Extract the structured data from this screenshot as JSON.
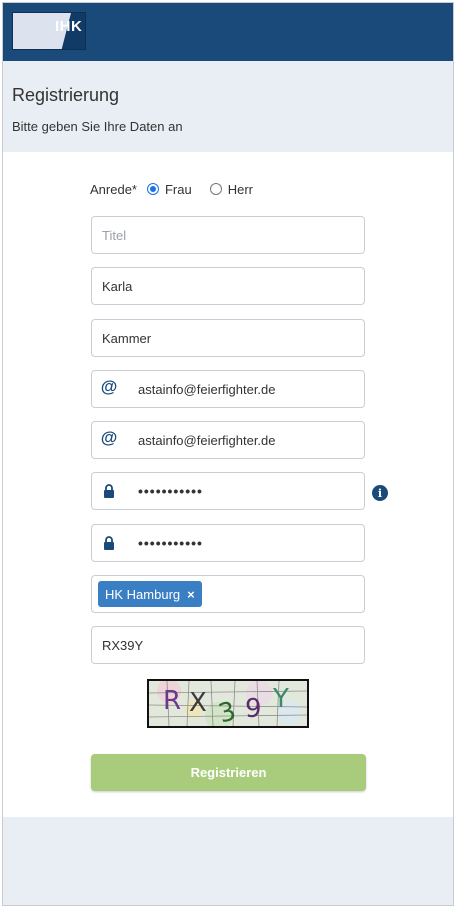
{
  "header": {
    "logo_text": "IHK"
  },
  "page": {
    "title": "Registrierung",
    "subtitle": "Bitte geben Sie Ihre Daten an"
  },
  "form": {
    "anrede": {
      "label": "Anrede*",
      "options": [
        "Frau",
        "Herr"
      ],
      "selected": "Frau"
    },
    "title_field": {
      "placeholder": "Titel",
      "value": ""
    },
    "first_name": {
      "value": "Karla"
    },
    "last_name": {
      "value": "Kammer"
    },
    "email": {
      "icon": "at-icon",
      "value": "astainfo@feierfighter.de"
    },
    "email_confirm": {
      "icon": "at-icon",
      "value": "astainfo@feierfighter.de"
    },
    "password": {
      "icon": "lock-icon",
      "value": "•••••••••••"
    },
    "password_confirm": {
      "icon": "lock-icon",
      "value": "•••••••••••"
    },
    "info_icon": "i",
    "chamber": {
      "tag": "HK Hamburg",
      "remove": "×"
    },
    "captcha_input": {
      "value": "RX39Y"
    },
    "captcha_image": {
      "text": "RX39Y"
    },
    "submit_label": "Registrieren"
  },
  "colors": {
    "header_bg": "#1a4a7a",
    "band_bg": "#e9eef4",
    "tag_bg": "#3a7fc4",
    "submit_bg": "#a8cc7c",
    "radio_accent": "#1a73e8"
  }
}
